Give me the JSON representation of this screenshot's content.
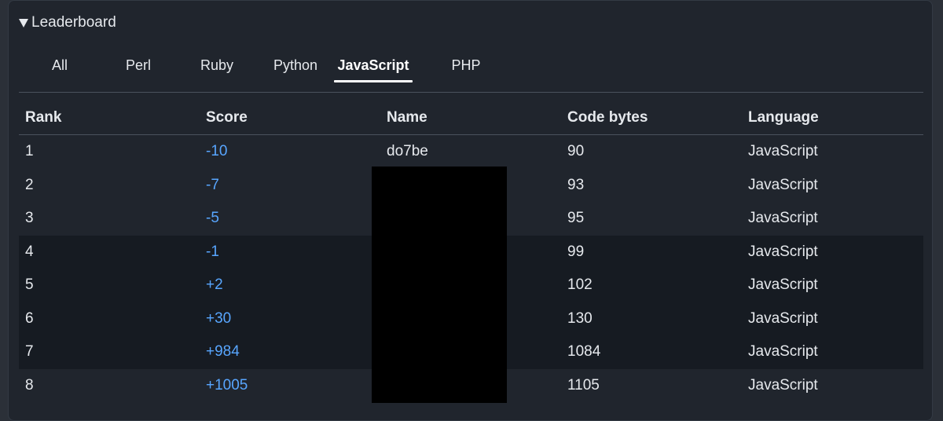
{
  "leaderboard": {
    "title": "Leaderboard",
    "tabs": [
      {
        "label": "All"
      },
      {
        "label": "Perl"
      },
      {
        "label": "Ruby"
      },
      {
        "label": "Python"
      },
      {
        "label": "JavaScript"
      },
      {
        "label": "PHP"
      }
    ],
    "active_tab": "JavaScript",
    "columns": [
      "Rank",
      "Score",
      "Name",
      "Code bytes",
      "Language"
    ],
    "rows": [
      {
        "rank": "1",
        "score": "-10",
        "name": "do7be",
        "bytes": "90",
        "language": "JavaScript"
      },
      {
        "rank": "2",
        "score": "-7",
        "name": "",
        "bytes": "93",
        "language": "JavaScript"
      },
      {
        "rank": "3",
        "score": "-5",
        "name": "",
        "bytes": "95",
        "language": "JavaScript"
      },
      {
        "rank": "4",
        "score": "-1",
        "name": "",
        "bytes": "99",
        "language": "JavaScript"
      },
      {
        "rank": "5",
        "score": "+2",
        "name": "",
        "bytes": "102",
        "language": "JavaScript"
      },
      {
        "rank": "6",
        "score": "+30",
        "name": "",
        "bytes": "130",
        "language": "JavaScript"
      },
      {
        "rank": "7",
        "score": "+984",
        "name": "",
        "bytes": "1084",
        "language": "JavaScript"
      },
      {
        "rank": "8",
        "score": "+1005",
        "name": "",
        "bytes": "1105",
        "language": "JavaScript"
      }
    ]
  },
  "colors": {
    "panel_bg": "#20252d",
    "alt_row_bg": "#161b22",
    "text": "#e6e9ed",
    "score_link": "#58a6ff",
    "redaction": "#000000"
  }
}
